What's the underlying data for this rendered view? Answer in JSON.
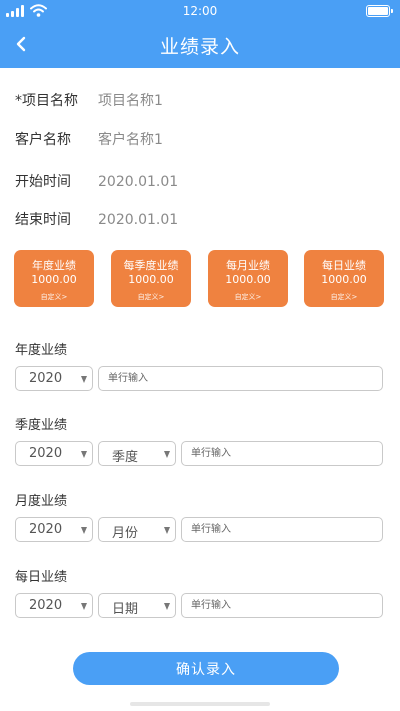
{
  "status_bar": {
    "time": "12:00"
  },
  "header": {
    "title": "业绩录入",
    "back_icon": "chevron-left-icon"
  },
  "info": [
    {
      "label": "*项目名称",
      "value": "项目名称1"
    },
    {
      "label": "客户名称",
      "value": "客户名称1"
    },
    {
      "label": "开始时间",
      "value": "2020.01.01"
    },
    {
      "label": "结束时间",
      "value": "2020.01.01"
    }
  ],
  "stats": [
    {
      "title": "年度业绩",
      "value": "1000.00",
      "link": "自定义>"
    },
    {
      "title": "每季度业绩",
      "value": "1000.00",
      "link": "自定义>"
    },
    {
      "title": "每月业绩",
      "value": "1000.00",
      "link": "自定义>"
    },
    {
      "title": "每日业绩",
      "value": "1000.00",
      "link": "自定义>"
    }
  ],
  "sections": {
    "annual": {
      "title": "年度业绩",
      "year": "2020",
      "placeholder": "单行输入"
    },
    "quarterly": {
      "title": "季度业绩",
      "year": "2020",
      "period": "季度",
      "placeholder": "单行输入"
    },
    "monthly": {
      "title": "月度业绩",
      "year": "2020",
      "period": "月份",
      "placeholder": "单行输入"
    },
    "daily": {
      "title": "每日业绩",
      "year": "2020",
      "period": "日期",
      "placeholder": "单行输入"
    }
  },
  "confirm": {
    "label": "确认录入"
  },
  "colors": {
    "primary": "#4a9ff5",
    "card": "#ef8240"
  }
}
